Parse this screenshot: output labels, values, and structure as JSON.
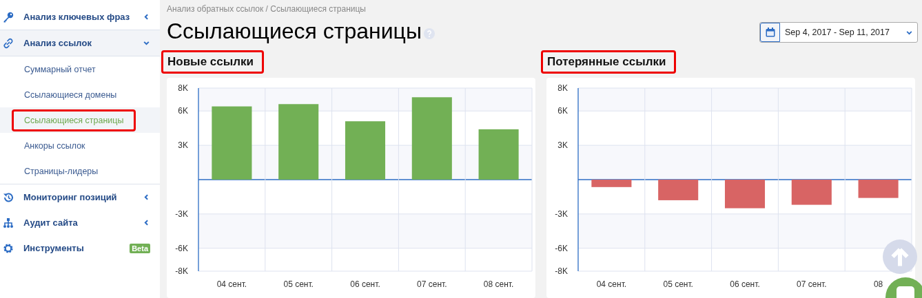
{
  "sidebar": {
    "items": [
      {
        "label": "Анализ ключевых фраз",
        "expanded": false,
        "selected": false
      },
      {
        "label": "Анализ ссылок",
        "expanded": true,
        "selected": true,
        "children": [
          {
            "label": "Суммарный отчет",
            "selected": false,
            "highlighted": false
          },
          {
            "label": "Ссылающиеся домены",
            "selected": false,
            "highlighted": false
          },
          {
            "label": "Ссылающиеся страницы",
            "selected": true,
            "highlighted": true
          },
          {
            "label": "Анкоры ссылок",
            "selected": false,
            "highlighted": false
          },
          {
            "label": "Страницы-лидеры",
            "selected": false,
            "highlighted": false
          }
        ]
      },
      {
        "label": "Мониторинг позиций",
        "expanded": false,
        "selected": false
      },
      {
        "label": "Аудит сайта",
        "expanded": false,
        "selected": false
      },
      {
        "label": "Инструменты",
        "badge": "Beta",
        "selected": false
      }
    ]
  },
  "breadcrumb": "Анализ обратных ссылок / Ссылающиеся страницы",
  "page_title": "Ссылающиеся страницы",
  "date_range": "Sep 4, 2017 - Sep 11, 2017",
  "panels": [
    {
      "title": "Новые ссылки",
      "highlighted": true,
      "chart_data": {
        "type": "bar",
        "categories": [
          "04 сент.",
          "05 сент.",
          "06 сент.",
          "07 сент.",
          "08 сент."
        ],
        "series": [
          {
            "color": "#72b055",
            "values": [
              6400,
              6600,
              5100,
              7200,
              4400
            ]
          }
        ],
        "grid": true,
        "ylim": [
          -8000,
          8000
        ],
        "yticks": [
          {
            "value": -8000,
            "label": "-8K"
          },
          {
            "value": -6000,
            "label": "-6K"
          },
          {
            "value": -3000,
            "label": "-3K"
          },
          {
            "value": 3000,
            "label": "3K"
          },
          {
            "value": 6000,
            "label": "6K"
          },
          {
            "value": 8000,
            "label": "8K"
          }
        ]
      }
    },
    {
      "title": "Потерянные ссылки",
      "highlighted": true,
      "chart_data": {
        "type": "bar",
        "categories": [
          "04 сент.",
          "05 сент.",
          "06 сент.",
          "07 сент.",
          "08"
        ],
        "series": [
          {
            "color": "#d86464",
            "values": [
              -650,
              -1800,
              -2500,
              -2200,
              -1600
            ]
          }
        ],
        "grid": true,
        "ylim": [
          -8000,
          8000
        ],
        "yticks": [
          {
            "value": -8000,
            "label": "-8K"
          },
          {
            "value": -6000,
            "label": "-6K"
          },
          {
            "value": -3000,
            "label": "-3K"
          },
          {
            "value": 3000,
            "label": "3K"
          },
          {
            "value": 6000,
            "label": "6K"
          },
          {
            "value": 8000,
            "label": "8K"
          }
        ]
      }
    }
  ]
}
